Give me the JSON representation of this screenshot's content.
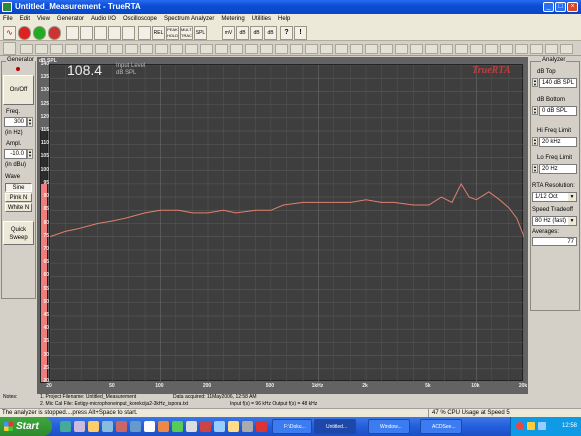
{
  "window": {
    "title": "Untitled_Measurement - TrueRTA",
    "min": "_",
    "max": "□",
    "close": "×"
  },
  "menu": [
    "File",
    "Edit",
    "View",
    "Generator",
    "Audio I/O",
    "Oscilloscope",
    "Spectrum Analyzer",
    "Metering",
    "Utilities",
    "Help"
  ],
  "toolbar": [
    "REL",
    "PEAK HOLD",
    "MULTI TRACE",
    "SPL",
    "mV",
    "dB",
    "dB",
    "dB",
    "?",
    "!"
  ],
  "generator": {
    "title": "Generator",
    "onoff_label": "On/Off",
    "freq_label": "Freq.",
    "freq_value": "300",
    "freq_unit": "(in Hz)",
    "ampl_label": "Ampl.",
    "ampl_value": "-10.0",
    "ampl_unit": "(in dBu)",
    "wave_label": "Wave",
    "waves": [
      "Sine",
      "Pink N",
      "White N"
    ],
    "sweep_label": "Quick\nSweep"
  },
  "graph": {
    "y_unit_top": "dB SPL",
    "readout": "108.4",
    "readout_label1": "Input Level",
    "readout_label2": "dB SPL",
    "brand": "TrueRTA",
    "y_ticks": [
      "140",
      "135",
      "130",
      "125",
      "120",
      "115",
      "110",
      "105",
      "100",
      "95",
      "90",
      "85",
      "80",
      "75",
      "70",
      "65",
      "60",
      "55",
      "50",
      "45",
      "40",
      "35",
      "30",
      "25",
      "20"
    ],
    "x_ticks": [
      "20",
      "50",
      "100",
      "200",
      "500",
      "1kHz",
      "2k",
      "5k",
      "10k",
      "20k"
    ],
    "level_fraction": 0.79,
    "trace_color": "#e08070",
    "bar_color": "#f07c7c"
  },
  "chart_data": {
    "type": "line",
    "xlabel": "",
    "ylabel": "dB SPL",
    "x_scale": "log",
    "xlim": [
      20,
      20000
    ],
    "ylim": [
      20,
      140
    ],
    "series": [
      {
        "x": [
          20,
          25,
          30,
          40,
          50,
          60,
          80,
          100,
          130,
          160,
          200,
          250,
          300,
          400,
          500,
          600,
          800,
          1000,
          1300,
          1600,
          2000,
          2500,
          3000,
          4000,
          5000,
          6000,
          7000,
          8000,
          9000,
          10000,
          12000,
          14000,
          16000,
          18000,
          20000
        ],
        "values": [
          75,
          77,
          78,
          80,
          81,
          82,
          84,
          85,
          85,
          84,
          84,
          85,
          84,
          85,
          85,
          87,
          88,
          88,
          88,
          88,
          89,
          88,
          88,
          87,
          87,
          90,
          88,
          95,
          90,
          89,
          92,
          89,
          86,
          82,
          75
        ]
      }
    ]
  },
  "analyzer": {
    "title": "Analyzer",
    "db_top_label": "dB Top",
    "db_top_value": "140 dB SPL",
    "db_bottom_label": "dB Bottom",
    "db_bottom_value": "0 dB SPL",
    "hi_label": "Hi Freq Limit",
    "hi_value": "20 kHz",
    "lo_label": "Lo Freq Limit",
    "lo_value": "20 Hz",
    "res_label": "RTA Resolution:",
    "res_value": "1/12 Oct",
    "speed_label": "Speed Tradeoff",
    "speed_value": "80 Hz (fast)",
    "avg_label": "Averages:",
    "avg_value": "77"
  },
  "notes": {
    "label": "Notes:",
    "line1": "1. Project Filename:  Untitled_Measurement",
    "acquired": "Data acquired:  11May2006, 12:58 AM",
    "line2": "2. Mic Cal File:  Extigy-microphoneinput_korekcija2-3kHz_ispora.txt",
    "io": "Input f(s) = 96 kHz    Output f(s) = 48 kHz"
  },
  "status": {
    "left": "The analyzer is stopped....press Alt+Space to start.",
    "right": "47 % CPU Usage at Speed 5"
  },
  "taskbar": {
    "start": "Start",
    "tasks": [
      "F:\\Doku...",
      "Untitled...",
      "Window...",
      "ACDSee..."
    ],
    "clock": "12:58"
  }
}
